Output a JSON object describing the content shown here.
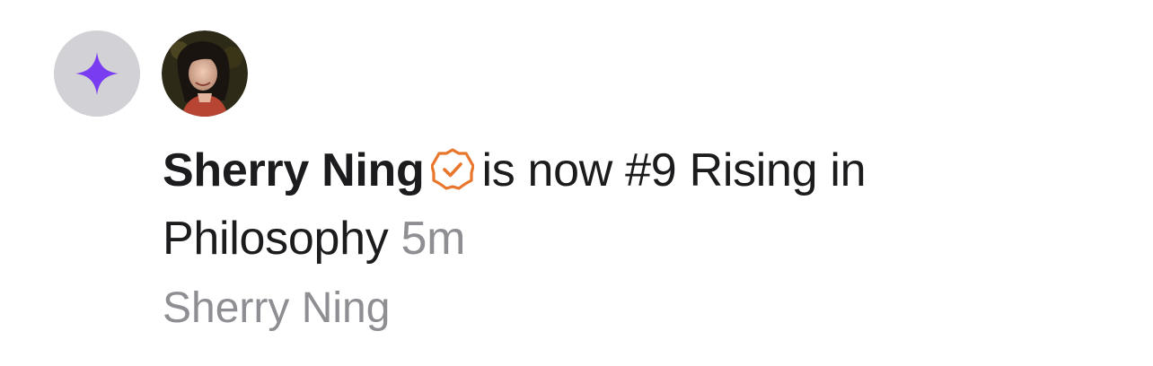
{
  "notification": {
    "badge_icon": "sparkle-icon",
    "accent_color": "#7a3cf0",
    "verified_color": "#e8762c",
    "avatar_alt": "Sherry Ning",
    "actor_name": "Sherry Ning",
    "message_text": "is now #9 Rising in Philosophy",
    "time_ago": "5m",
    "subtitle": "Sherry Ning"
  }
}
